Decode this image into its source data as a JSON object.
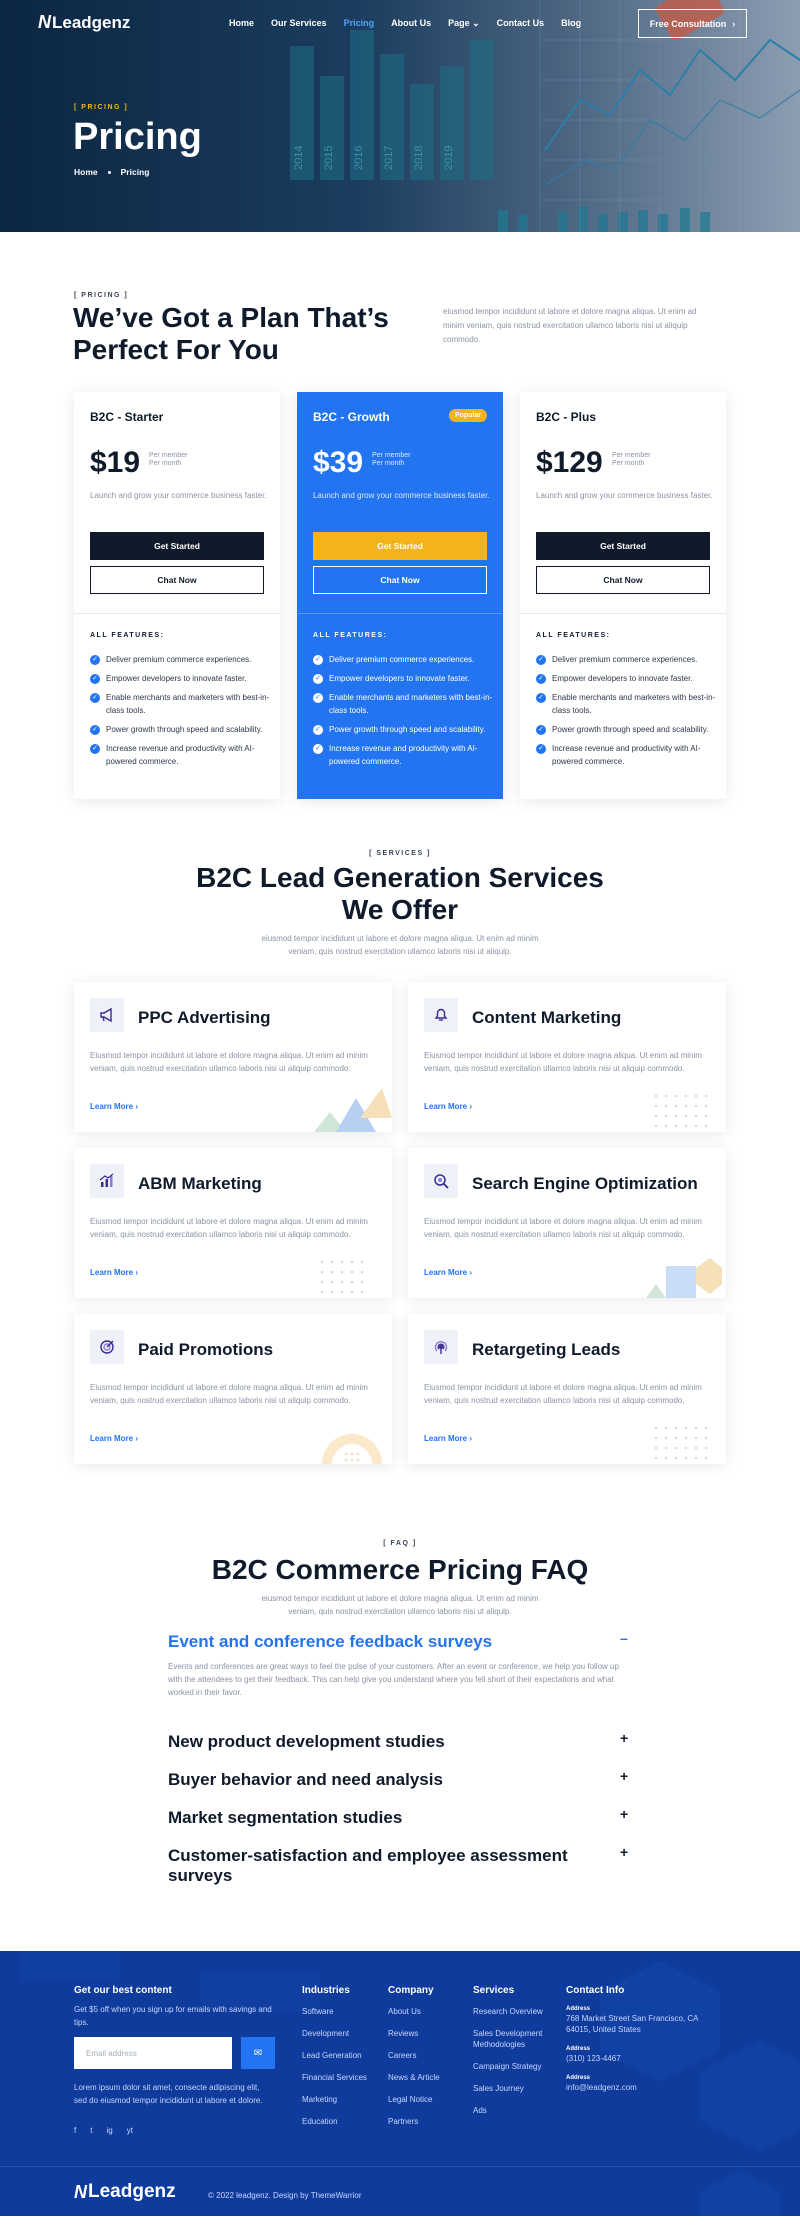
{
  "brand": {
    "name": "Leadgenz",
    "mark": "N"
  },
  "colors": {
    "accent": "#2374f0",
    "gold": "#f4b31a",
    "dark": "#0f1a2b",
    "footer": "#0e3b9c"
  },
  "nav": {
    "links": [
      "Home",
      "Our Services",
      "Pricing",
      "About Us",
      "Page",
      "Contact Us",
      "Blog"
    ],
    "page_caret": "chevron-down-icon",
    "cta": "Free Consultation"
  },
  "hero": {
    "kicker": "[ PRICING ]",
    "title": "Pricing",
    "breadcrumb": [
      "Home",
      "Pricing"
    ],
    "chart_years": [
      "2014",
      "2015",
      "2016",
      "2017",
      "2018",
      "2019"
    ]
  },
  "pricing": {
    "kicker": "[ PRICING ]",
    "title": "We’ve Got a Plan That’s Perfect For You",
    "description": "eiusmod tempor incididunt ut labore et dolore magna aliqua. Ut enim ad minim veniam, quis nostrud exercitation ullamco laboris nisi ut aliquip commodo.",
    "features_label": "ALL FEATURES:",
    "per_line1": "Per member",
    "per_line2": "Per month",
    "plans": [
      {
        "name": "B2C - Starter",
        "price": "$19",
        "badge": "",
        "description": "Launch and grow your commerce business faster.",
        "primary_cta": "Get Started",
        "secondary_cta": "Chat Now",
        "features": [
          "Deliver premium commerce experiences.",
          "Empower developers to innovate faster.",
          "Enable merchants and marketers with best-in-class tools.",
          "Power growth through speed and scalability.",
          "Increase revenue and productivity with AI-powered commerce."
        ]
      },
      {
        "name": "B2C - Growth",
        "price": "$39",
        "badge": "Popular",
        "description": "Launch and grow your commerce business faster.",
        "primary_cta": "Get Started",
        "secondary_cta": "Chat Now",
        "features": [
          "Deliver premium commerce experiences.",
          "Empower developers to innovate faster.",
          "Enable merchants and marketers with best-in-class tools.",
          "Power growth through speed and scalability.",
          "Increase revenue and productivity with AI-powered commerce."
        ]
      },
      {
        "name": "B2C - Plus",
        "price": "$129",
        "badge": "",
        "description": "Launch and grow your commerce business faster.",
        "primary_cta": "Get Started",
        "secondary_cta": "Chat Now",
        "features": [
          "Deliver premium commerce experiences.",
          "Empower developers to innovate faster.",
          "Enable merchants and marketers with best-in-class tools.",
          "Power growth through speed and scalability.",
          "Increase revenue and productivity with AI-powered commerce."
        ]
      }
    ]
  },
  "services": {
    "kicker": "[ SERVICES ]",
    "title_line1": "B2C Lead Generation Services",
    "title_line2": "We Offer",
    "description": "eiusmod tempor incididunt ut labore et dolore magna aliqua. Ut enim ad minim veniam, quis nostrud exercitation ullamco laboris nisi ut aliquip.",
    "learn_more": "Learn More",
    "items": [
      {
        "title": "PPC Advertising",
        "icon": "megaphone-icon",
        "description": "Eiusmod tempor incididunt ut labore et dolore magna aliqua. Ut enim ad minim veniam, quis nostrud exercitation ullamco laboris nisi ut aliquip commodo."
      },
      {
        "title": "Content Marketing",
        "icon": "bell-icon",
        "description": "Eiusmod tempor incididunt ut labore et dolore magna aliqua. Ut enim ad minim veniam, quis nostrud exercitation ullamco laboris nisi ut aliquip commodo."
      },
      {
        "title": "ABM Marketing",
        "icon": "growth-chart-icon",
        "description": "Eiusmod tempor incididunt ut labore et dolore magna aliqua. Ut enim ad minim veniam, quis nostrud exercitation ullamco laboris nisi ut aliquip commodo."
      },
      {
        "title": "Search Engine Optimization",
        "icon": "search-icon",
        "description": "Eiusmod tempor incididunt ut labore et dolore magna aliqua. Ut enim ad minim veniam, quis nostrud exercitation ullamco laboris nisi ut aliquip commodo."
      },
      {
        "title": "Paid Promotions",
        "icon": "target-icon",
        "description": "Eiusmod tempor incididunt ut labore et dolore magna aliqua. Ut enim ad minim veniam, quis nostrud exercitation ullamco laboris nisi ut aliquip commodo."
      },
      {
        "title": "Retargeting Leads",
        "icon": "broadcast-icon",
        "description": "Eiusmod tempor incididunt ut labore et dolore magna aliqua. Ut enim ad minim veniam, quis nostrud exercitation ullamco laboris nisi ut aliquip commodo."
      }
    ]
  },
  "faq": {
    "kicker": "[ FAQ ]",
    "title": "B2C Commerce Pricing FAQ",
    "description": "eiusmod tempor incididunt ut labore et dolore magna aliqua. Ut enim ad minim veniam, quis nostrud exercitation ullamco laboris nisi ut aliquip.",
    "items": [
      {
        "question": "Event and conference feedback surveys",
        "open": true,
        "answer": "Events and conferences are great ways to feel the pulse of your customers. After an event or conference, we help you follow up with the attendees to get their feedback. This can help give you understand where you fell short of their expectations and what worked in their favor."
      },
      {
        "question": "New product development studies",
        "open": false
      },
      {
        "question": "Buyer behavior and need analysis",
        "open": false
      },
      {
        "question": "Market segmentation studies",
        "open": false
      },
      {
        "question": "Customer-satisfaction and employee assessment surveys",
        "open": false
      }
    ],
    "open_symbol": "–",
    "closed_symbol": "+"
  },
  "footer": {
    "newsletter_title": "Get our best content",
    "newsletter_text": "Get $5 off when you sign up for emails with savings and tips.",
    "email_placeholder": "Email address",
    "about_text": "Lorem ipsum dolor sit amet, consecte adipiscing elit, sed do eiusmod tempor incididunt ut labore et dolore.",
    "social": [
      "f",
      "t",
      "ig",
      "yt"
    ],
    "columns": [
      {
        "title": "Industries",
        "links": [
          "Software",
          "Development",
          "Lead Generation",
          "Financial Services",
          "Marketing",
          "Education"
        ]
      },
      {
        "title": "Company",
        "links": [
          "About Us",
          "Reviews",
          "Careers",
          "News & Article",
          "Legal Notice",
          "Partners"
        ]
      },
      {
        "title": "Services",
        "links": [
          "Research Overview",
          "Sales Development Methodologies",
          "Campaign Strategy",
          "Sales Journey",
          "Ads"
        ]
      }
    ],
    "contact": {
      "title": "Contact Info",
      "address_label": "Address",
      "address": "768 Market Street San Francisco, CA 64015, United States",
      "phone_label": "Address",
      "phone": "(310) 123-4467",
      "email_label": "Address",
      "email": "info@leadgenz.com"
    },
    "copyright": "© 2022 leadgenz. Design by ThemeWarrior"
  }
}
